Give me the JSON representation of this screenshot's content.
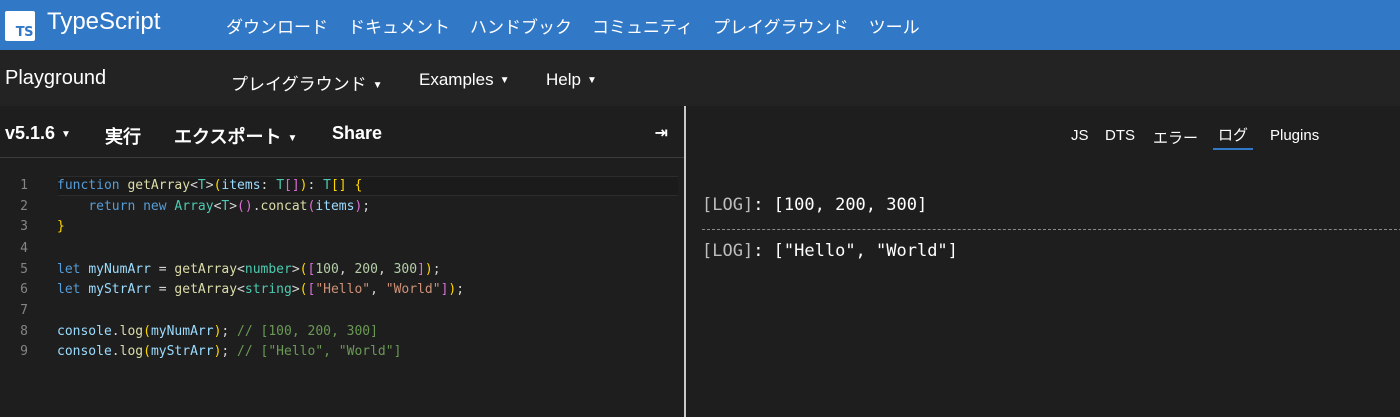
{
  "topnav": {
    "logo_text": "TS",
    "brand": "TypeScript",
    "links": [
      "ダウンロード",
      "ドキュメント",
      "ハンドブック",
      "コミュニティ",
      "プレイグラウンド",
      "ツール"
    ]
  },
  "subnav": {
    "title": "Playground",
    "menus": [
      "プレイグラウンド",
      "Examples",
      "Help"
    ]
  },
  "toolbar": {
    "version": "v5.1.6",
    "run": "実行",
    "export": "エクスポート",
    "share": "Share",
    "collapse_icon": "⇥"
  },
  "editor": {
    "line_numbers": [
      "1",
      "2",
      "3",
      "4",
      "5",
      "6",
      "7",
      "8",
      "9"
    ]
  },
  "output_tabs": [
    "JS",
    "DTS",
    "エラー",
    "ログ",
    "Plugins"
  ],
  "active_tab": "ログ",
  "logs": [
    {
      "tag": "[LOG]",
      "text": "[100, 200, 300]"
    },
    {
      "tag": "[LOG]",
      "text": "[\"Hello\", \"World\"]"
    }
  ],
  "colors": {
    "brand_blue": "#3178c6",
    "subnav_bg": "#232323",
    "editor_bg": "#1e1e1e"
  }
}
